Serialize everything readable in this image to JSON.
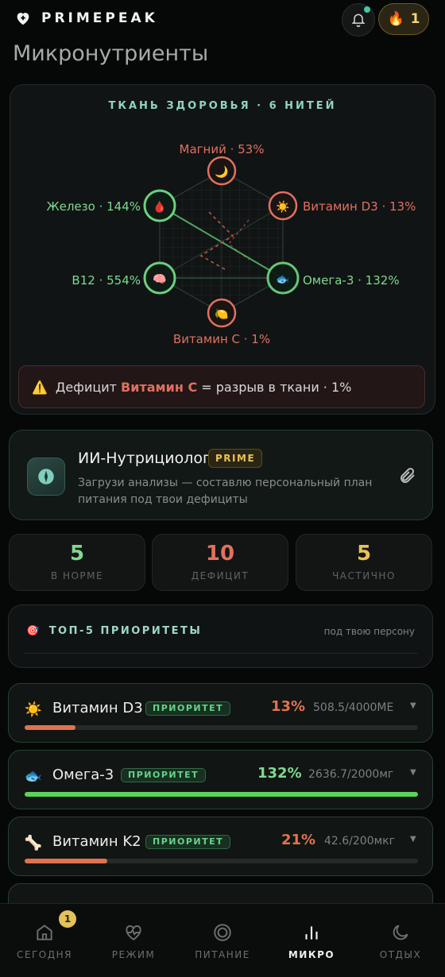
{
  "app": {
    "name": "PRIMEPEAK",
    "streak_count": "1",
    "page_title": "Микронутриенты"
  },
  "fabric": {
    "title": "ТКАНЬ ЗДОРОВЬЯ · 6 НИТЕЙ",
    "nodes": [
      {
        "label": "Магний · 53%",
        "icon": "moon",
        "status": "deficit",
        "color": "#e2705f"
      },
      {
        "label": "Витамин D3 · 13%",
        "icon": "sun",
        "status": "deficit",
        "color": "#e2705f"
      },
      {
        "label": "Омега-3 · 132%",
        "icon": "fish",
        "status": "normal",
        "color": "#7fd98f"
      },
      {
        "label": "Витамин C · 1%",
        "icon": "lemon",
        "status": "deficit",
        "color": "#e2705f"
      },
      {
        "label": "B12 · 554%",
        "icon": "brain",
        "status": "normal",
        "color": "#7fd98f"
      },
      {
        "label": "Железо · 144%",
        "icon": "drop",
        "status": "normal",
        "color": "#7fd98f"
      }
    ],
    "alert": {
      "prefix": "Дефицит",
      "highlight": "Витамин C",
      "suffix": "= разрыв в ткани · 1%"
    }
  },
  "ai": {
    "title": "ИИ-Нутрициолог",
    "badge": "PRIME",
    "description": "Загрузи анализы — составлю персональный план питания под твои дефициты"
  },
  "stats": [
    {
      "value": "5",
      "label": "В НОРМЕ",
      "color": "#7fd98f"
    },
    {
      "value": "10",
      "label": "ДЕФИЦИТ",
      "color": "#e2705f"
    },
    {
      "value": "5",
      "label": "ЧАСТИЧНО",
      "color": "#e8c25a"
    }
  ],
  "top5": {
    "title": "ТОП-5 ПРИОРИТЕТЫ",
    "subtitle": "под твою персону"
  },
  "nutrients": [
    {
      "icon": "sun-icon",
      "glyph": "☀️",
      "name": "Витамин D3",
      "badge": "ПРИОРИТЕТ",
      "pct": "13%",
      "amount": "508.5/4000МЕ",
      "progress": 0.13,
      "color": "#e0734f"
    },
    {
      "icon": "fish-icon",
      "glyph": "🐟",
      "name": "Омега-3",
      "badge": "ПРИОРИТЕТ",
      "pct": "132%",
      "amount": "2636.7/2000мг",
      "progress": 1.0,
      "color": "#5ad35a"
    },
    {
      "icon": "bone-icon",
      "glyph": "🦴",
      "name": "Витамин K2",
      "badge": "ПРИОРИТЕТ",
      "pct": "21%",
      "amount": "42.6/200мкг",
      "progress": 0.21,
      "color": "#e0734f"
    }
  ],
  "nav": [
    {
      "label": "СЕГОДНЯ",
      "icon": "home-icon",
      "badge": "1"
    },
    {
      "label": "РЕЖИМ",
      "icon": "heart-pulse-icon"
    },
    {
      "label": "ПИТАНИЕ",
      "icon": "target-icon"
    },
    {
      "label": "МИКРО",
      "icon": "bars-icon",
      "active": true
    },
    {
      "label": "ОТДЫХ",
      "icon": "moon-icon"
    }
  ]
}
